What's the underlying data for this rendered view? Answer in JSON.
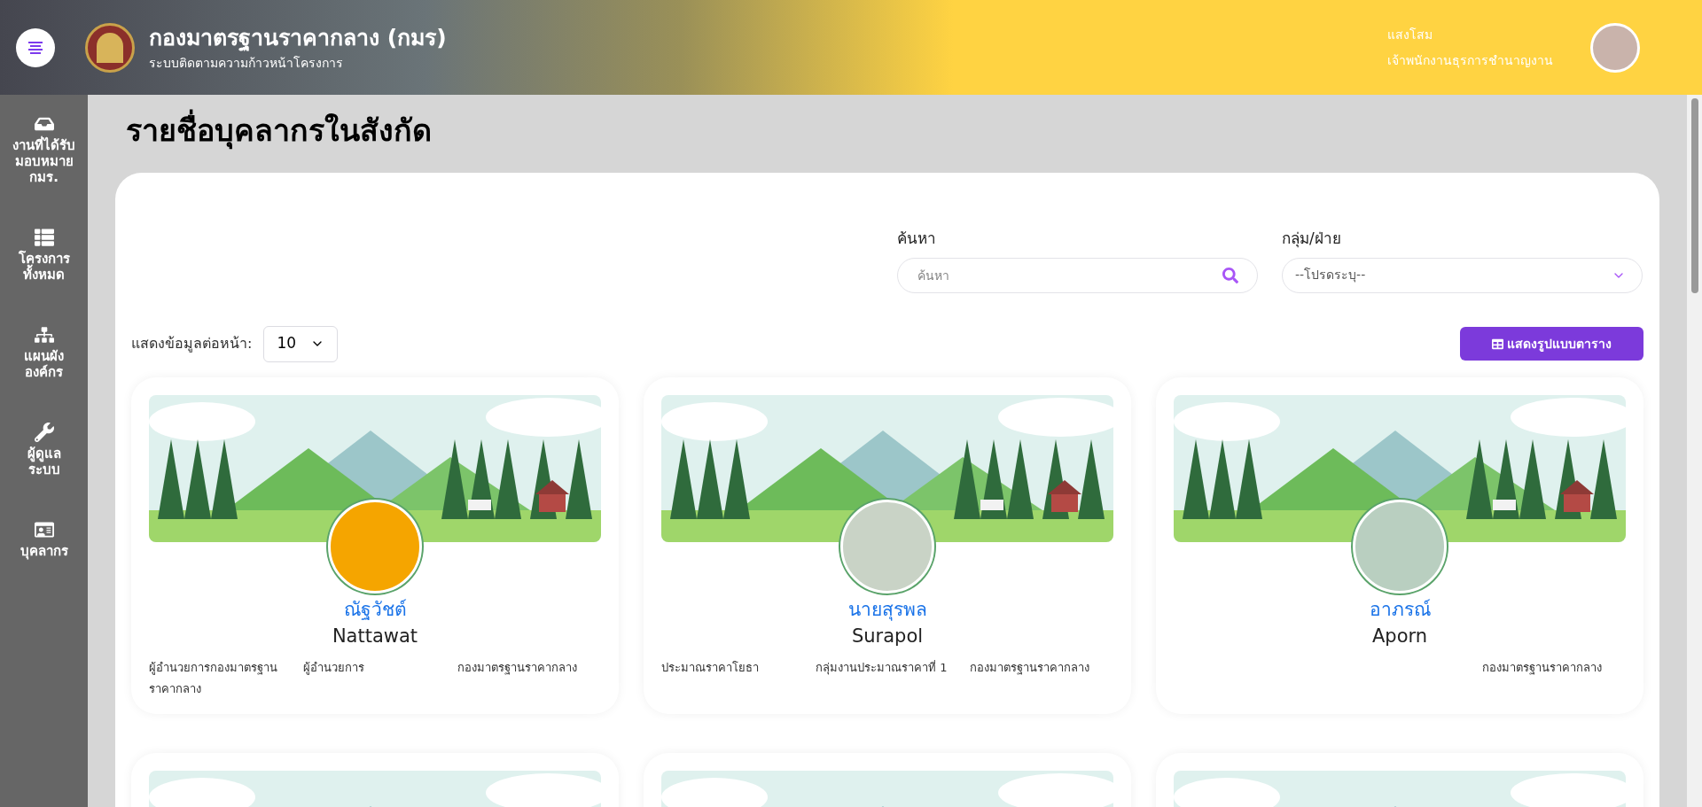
{
  "header": {
    "org_title": "กองมาตรฐานราคากลาง (กมร)",
    "subtitle": "ระบบติดตามความก้าวหน้าโครงการ",
    "user_name": "แสงโสม",
    "user_role": "เจ้าพนักงานธุรการชำนาญงาน"
  },
  "sidebar": {
    "items": [
      {
        "label": "งานที่ได้รับมอบหมาย กมร.",
        "selected": false
      },
      {
        "label": "โครงการทั้งหมด",
        "selected": false
      },
      {
        "label": "แผนผังองค์กร",
        "selected": false
      },
      {
        "label": "ผู้ดูแลระบบ",
        "selected": false
      },
      {
        "label": "บุคลากร",
        "selected": false
      }
    ]
  },
  "page_title": "รายชื่อบุคลากรในสังกัด",
  "filters": {
    "search_label": "ค้นหา",
    "search_placeholder": "ค้นหา",
    "group_label": "กลุ่ม/ฝ่าย",
    "group_value": "--โปรดระบุ--"
  },
  "per_page": {
    "label": "แสดงข้อมูลต่อหน้า:",
    "value": "10"
  },
  "table_view_button": "แสดงรูปแบบตาราง",
  "people": [
    {
      "kind": "full",
      "thai_name": "ณัฐวัชต์",
      "name": "Nattawat",
      "position": "ผู้อำนวยการกองมาตรฐานราคากลาง",
      "group": "ผู้อำนวยการ",
      "division": "กองมาตรฐานราคากลาง"
    },
    {
      "kind": "full",
      "thai_name": "นายสุรพล",
      "name": "Surapol",
      "position": "ประมาณราคาโยธา",
      "group": "กลุ่มงานประมาณราคาที่ 1",
      "division": "กองมาตรฐานราคากลาง"
    },
    {
      "kind": "full",
      "thai_name": "อาภรณ์",
      "name": "Aporn",
      "division": "กองมาตรฐานราคากลาง"
    },
    {
      "kind": "partial"
    },
    {
      "kind": "partial"
    },
    {
      "kind": "partial"
    }
  ]
}
